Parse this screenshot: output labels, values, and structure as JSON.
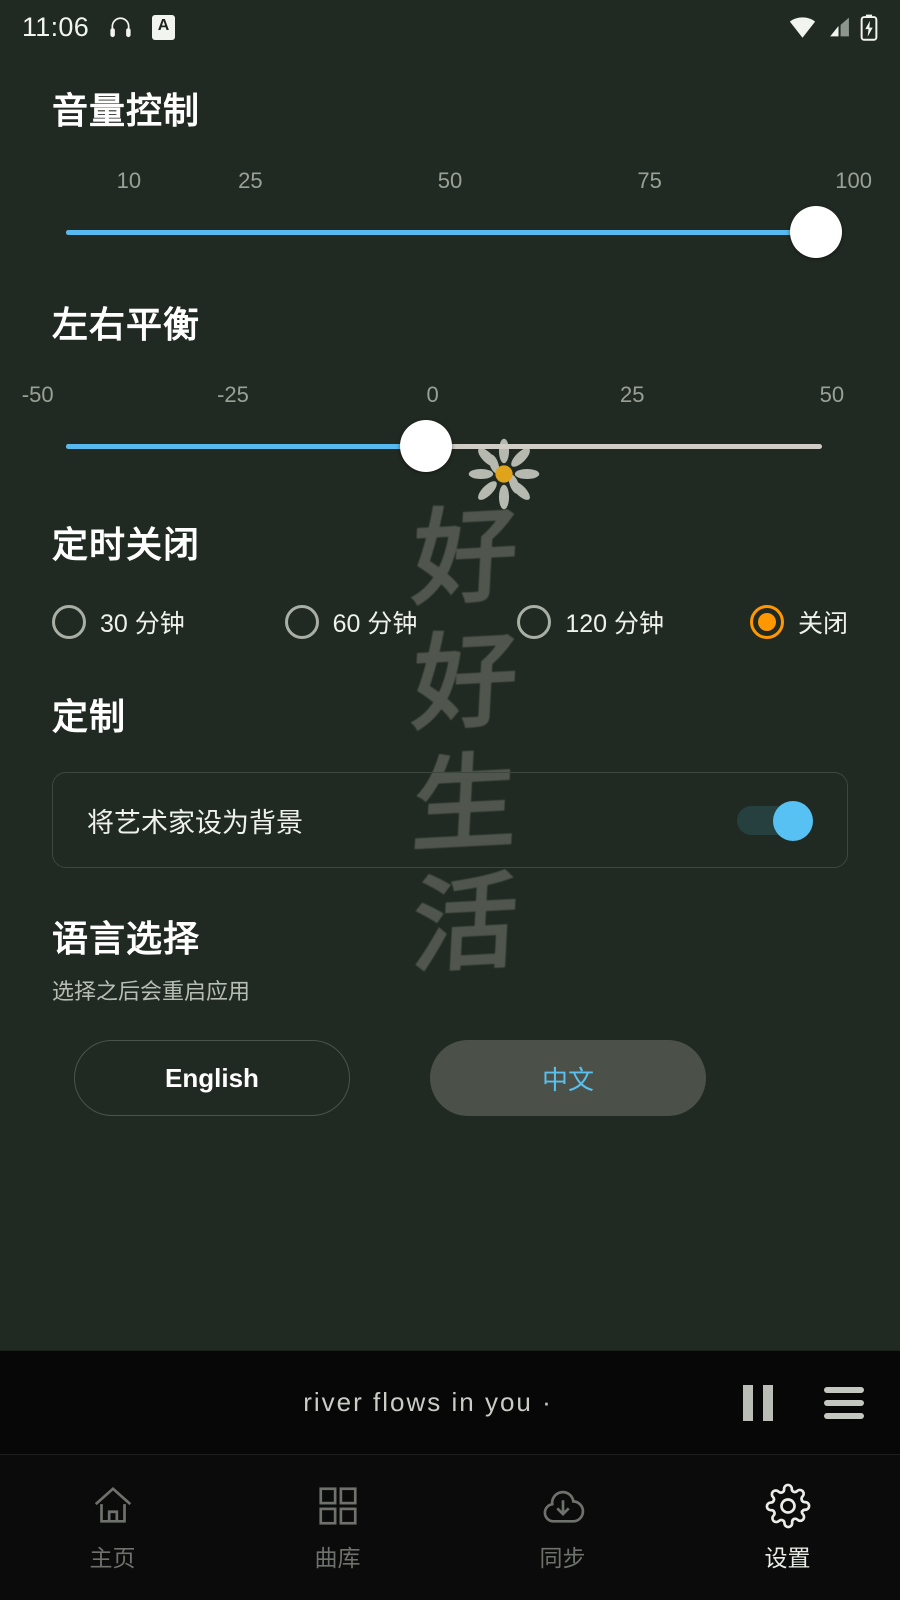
{
  "status_bar": {
    "time": "11:06",
    "headphone_icon": "headphone-icon",
    "badge_letter": "A",
    "wifi_icon": "wifi-icon",
    "signal_icon": "cellular-signal-icon",
    "battery_icon": "battery-charging-icon"
  },
  "background": {
    "calligraphy": [
      "好",
      "好",
      "生",
      "活"
    ],
    "flower_icon": "daisy-flower"
  },
  "volume": {
    "title": "音量控制",
    "ticks": [
      "10",
      "25",
      "50",
      "75",
      "100"
    ],
    "tick_positions": [
      6,
      20,
      43,
      66,
      90
    ],
    "value": 100,
    "min": 0,
    "max": 100,
    "fill_percent": 96,
    "accent_color": "#56b9ef"
  },
  "balance": {
    "title": "左右平衡",
    "ticks": [
      "-50",
      "-25",
      "0",
      "25",
      "50"
    ],
    "tick_positions": [
      2,
      25,
      50,
      75,
      98
    ],
    "value": 0,
    "min": -50,
    "max": 50,
    "fill_percent": 50,
    "accent_color": "#56b9ef"
  },
  "sleep_timer": {
    "title": "定时关闭",
    "options": [
      {
        "label": "30 分钟",
        "selected": false
      },
      {
        "label": "60 分钟",
        "selected": false
      },
      {
        "label": "120 分钟",
        "selected": false
      },
      {
        "label": "关闭",
        "selected": true
      }
    ],
    "selected_color": "#ff9800"
  },
  "customize": {
    "title": "定制",
    "toggle_label": "将艺术家设为背景",
    "toggle_on": true,
    "toggle_color": "#56c1f2"
  },
  "language": {
    "title": "语言选择",
    "subtitle": "选择之后会重启应用",
    "options": [
      {
        "label": "English",
        "selected": false
      },
      {
        "label": "中文",
        "selected": true
      }
    ],
    "selected_text_color": "#59c0f0",
    "selected_bg_color": "#4b5049"
  },
  "player": {
    "now_playing": "river  flows  in  you ·",
    "pause_icon": "pause-icon",
    "queue_icon": "queue-list-icon"
  },
  "bottom_nav": {
    "items": [
      {
        "label": "主页",
        "icon": "home-icon",
        "active": false
      },
      {
        "label": "曲库",
        "icon": "grid-library-icon",
        "active": false
      },
      {
        "label": "同步",
        "icon": "cloud-download-sync-icon",
        "active": false
      },
      {
        "label": "设置",
        "icon": "gear-settings-icon",
        "active": true
      }
    ]
  }
}
